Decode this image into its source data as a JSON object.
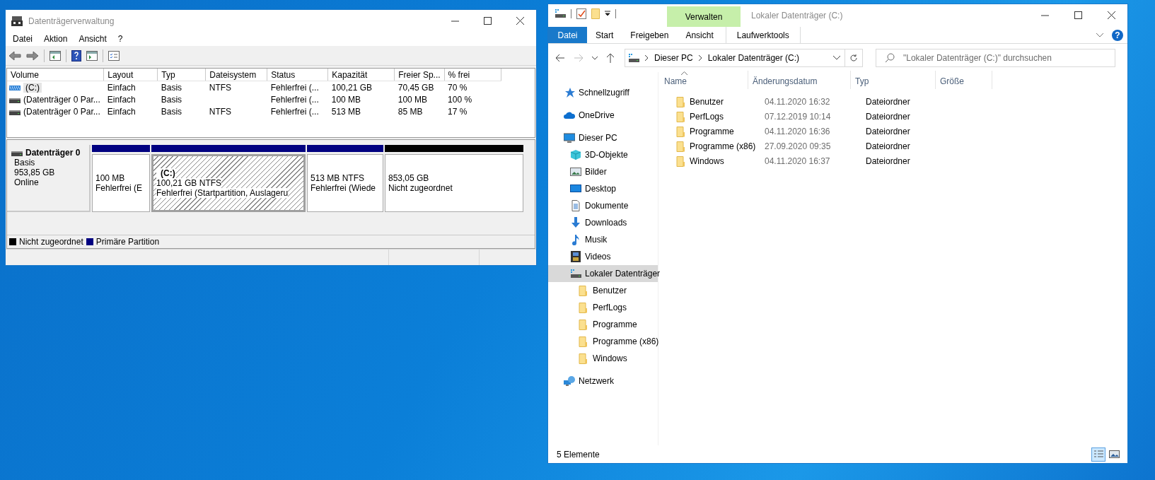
{
  "disk_management": {
    "window": {
      "title": "Datenträgerverwaltung"
    },
    "menu": [
      "Datei",
      "Aktion",
      "Ansicht",
      "?"
    ],
    "volume_table": {
      "columns": [
        "Volume",
        "Layout",
        "Typ",
        "Dateisystem",
        "Status",
        "Kapazität",
        "Freier Sp...",
        "% frei"
      ],
      "rows": [
        {
          "kind": "system",
          "selected": true,
          "cells": [
            "(C:)",
            "Einfach",
            "Basis",
            "NTFS",
            "Fehlerfrei (...",
            "100,21 GB",
            "70,45 GB",
            "70 %"
          ]
        },
        {
          "kind": "partition",
          "selected": false,
          "cells": [
            "(Datenträger 0 Par...",
            "Einfach",
            "Basis",
            "",
            "Fehlerfrei (...",
            "100 MB",
            "100 MB",
            "100 %"
          ]
        },
        {
          "kind": "partition",
          "selected": false,
          "cells": [
            "(Datenträger 0 Par...",
            "Einfach",
            "Basis",
            "NTFS",
            "Fehlerfrei (...",
            "513 MB",
            "85 MB",
            "17 %"
          ]
        }
      ]
    },
    "disk": {
      "name": "Datenträger 0",
      "type": "Basis",
      "size": "953,85 GB",
      "status": "Online"
    },
    "partitions": [
      {
        "kind": "primary",
        "selected": false,
        "size": "100 MB",
        "status": "Fehlerfrei (E"
      },
      {
        "kind": "primary",
        "selected": true,
        "label": "(C:)",
        "size": "100,21 GB NTFS",
        "status": "Fehlerfrei (Startpartition, Auslageru"
      },
      {
        "kind": "primary",
        "selected": false,
        "size": "513 MB NTFS",
        "status": "Fehlerfrei (Wiede"
      },
      {
        "kind": "unallocated",
        "selected": false,
        "size": "853,05 GB",
        "status": "Nicht zugeordnet"
      }
    ],
    "legend": [
      {
        "label": "Nicht zugeordnet",
        "color": "#000000"
      },
      {
        "label": "Primäre Partition",
        "color": "#000080"
      }
    ]
  },
  "explorer": {
    "window": {
      "title": "Lokaler Datenträger (C:)"
    },
    "context_tab": "Verwalten",
    "ribbon_tabs": [
      {
        "kind": "file",
        "label": "Datei",
        "selected": false
      },
      {
        "kind": "tab",
        "label": "Start",
        "selected": false
      },
      {
        "kind": "tab",
        "label": "Freigeben",
        "selected": false
      },
      {
        "kind": "tab",
        "label": "Ansicht",
        "selected": false
      },
      {
        "kind": "context",
        "label": "Laufwerktools",
        "selected": false
      }
    ],
    "help_button": "?",
    "address": [
      "Dieser PC",
      "Lokaler Datenträger (C:)"
    ],
    "search": {
      "placeholder": "\"Lokaler Datenträger (C:)\" durchsuchen"
    },
    "navigation": [
      {
        "kind": "star",
        "label": "Schnellzugriff",
        "selected": false
      },
      {
        "kind": "cloud",
        "label": "OneDrive",
        "selected": false
      },
      {
        "kind": "pc",
        "label": "Dieser PC",
        "selected": false,
        "children": [
          {
            "kind": "cube",
            "label": "3D-Objekte",
            "selected": false
          },
          {
            "kind": "pictures",
            "label": "Bilder",
            "selected": false
          },
          {
            "kind": "desktop",
            "label": "Desktop",
            "selected": false
          },
          {
            "kind": "document",
            "label": "Dokumente",
            "selected": false
          },
          {
            "kind": "download",
            "label": "Downloads",
            "selected": false
          },
          {
            "kind": "music",
            "label": "Musik",
            "selected": false
          },
          {
            "kind": "video",
            "label": "Videos",
            "selected": false
          },
          {
            "kind": "drive",
            "label": "Lokaler Datenträger",
            "selected": true,
            "children": [
              {
                "kind": "folder",
                "label": "Benutzer",
                "selected": false
              },
              {
                "kind": "folder",
                "label": "PerfLogs",
                "selected": false
              },
              {
                "kind": "folder",
                "label": "Programme",
                "selected": false
              },
              {
                "kind": "folder",
                "label": "Programme (x86)",
                "selected": false
              },
              {
                "kind": "folder",
                "label": "Windows",
                "selected": false
              }
            ]
          }
        ]
      },
      {
        "kind": "network",
        "label": "Netzwerk",
        "selected": false
      }
    ],
    "columns": [
      {
        "label": "Name",
        "sorted": true
      },
      {
        "label": "Änderungsdatum",
        "sorted": false
      },
      {
        "label": "Typ",
        "sorted": false
      },
      {
        "label": "Größe",
        "sorted": false
      }
    ],
    "files": [
      {
        "name": "Benutzer",
        "date": "04.11.2020 16:32",
        "type": "Dateiordner"
      },
      {
        "name": "PerfLogs",
        "date": "07.12.2019 10:14",
        "type": "Dateiordner"
      },
      {
        "name": "Programme",
        "date": "04.11.2020 16:36",
        "type": "Dateiordner"
      },
      {
        "name": "Programme (x86)",
        "date": "27.09.2020 09:35",
        "type": "Dateiordner"
      },
      {
        "name": "Windows",
        "date": "04.11.2020 16:37",
        "type": "Dateiordner"
      }
    ],
    "status": "5 Elemente",
    "views": [
      {
        "kind": "details",
        "selected": true
      },
      {
        "kind": "large-icons",
        "selected": false
      }
    ]
  }
}
